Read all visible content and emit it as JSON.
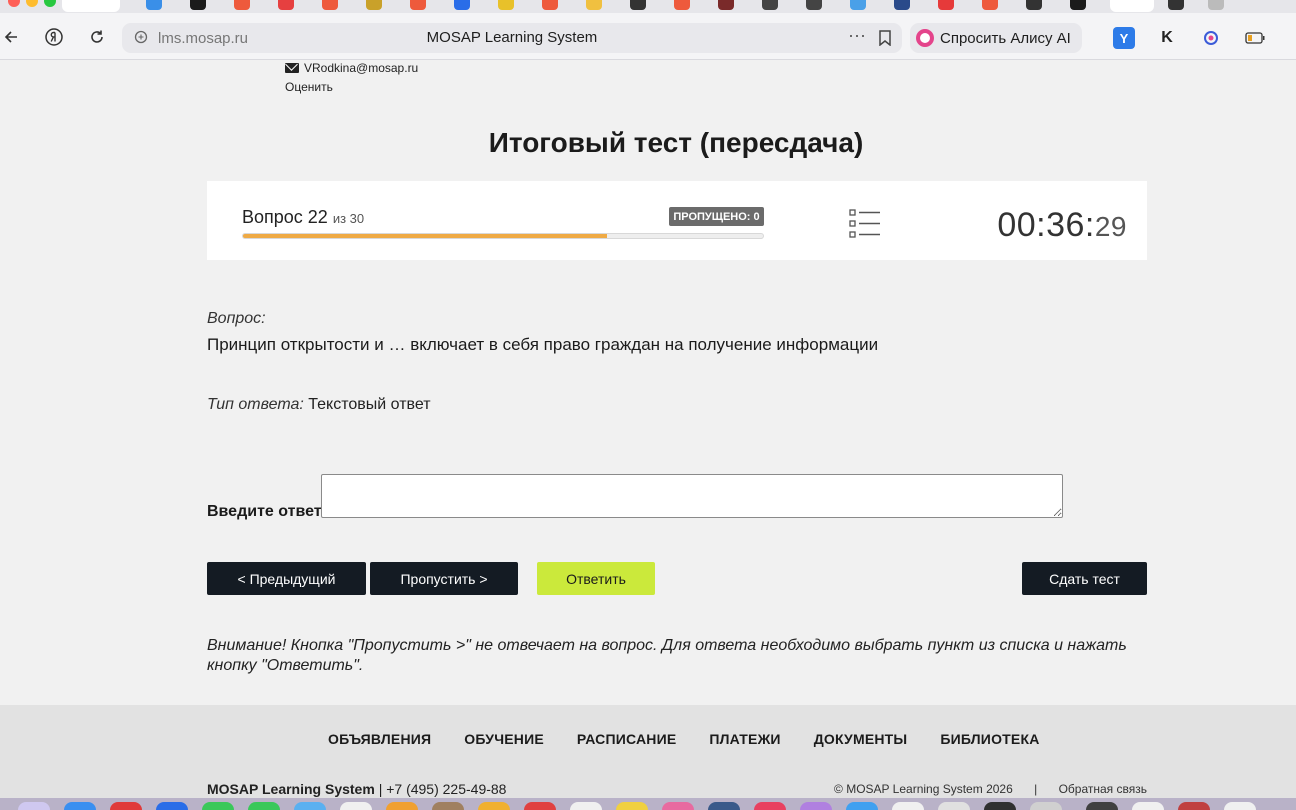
{
  "browser": {
    "url": "lms.mosap.ru",
    "page_title": "MOSAP Learning System",
    "more_icon": "ellipsis-icon",
    "bookmark_icon": "bookmark-icon",
    "alice_label": "Спросить Алису AI"
  },
  "profile": {
    "email": "VRodkina@mosap.ru",
    "rate_label": "Оценить"
  },
  "test": {
    "title": "Итоговый тест (пересдача)",
    "question_label": "Вопрос 22",
    "question_total": "из 30",
    "skipped_badge": "ПРОПУЩЕНО: 0",
    "progress_fraction": 0.7,
    "timer_main": "00:36:",
    "timer_seconds": "29"
  },
  "question": {
    "label": "Вопрос:",
    "text": "Принцип открытости и … включает в себя право граждан на получение информации",
    "answer_type_label": "Тип ответа:",
    "answer_type_value": "Текстовый ответ",
    "input_label": "Введите ответ:",
    "input_value": ""
  },
  "buttons": {
    "previous": "< Предыдущий",
    "skip": "Пропустить >",
    "answer": "Ответить",
    "submit": "Сдать тест"
  },
  "notice": "Внимание! Кнопка \"Пропустить >\" не отвечает на вопрос. Для ответа необходимо выбрать пункт из списка и нажать кнопку \"Ответить\".",
  "footer": {
    "nav": [
      "ОБЪЯВЛЕНИЯ",
      "ОБУЧЕНИЕ",
      "РАСПИСАНИЕ",
      "ПЛАТЕЖИ",
      "ДОКУМЕНТЫ",
      "БИБЛИОТЕКА"
    ],
    "brand": "MOSAP Learning System",
    "phone": "| +7 (495) 225-49-88",
    "copyright": "© MOSAP Learning System 2026",
    "separator": "|",
    "feedback": "Обратная связь"
  },
  "colors": {
    "accent_lime": "#cbe93b",
    "progress_orange": "#efaa45",
    "dark_button": "#141b23"
  }
}
